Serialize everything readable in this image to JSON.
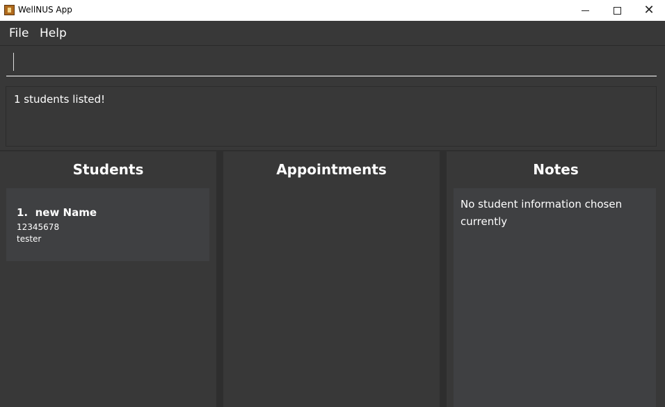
{
  "window": {
    "title": "WellNUS App",
    "icon": "app-icon"
  },
  "menu": {
    "file": "File",
    "help": "Help"
  },
  "command": {
    "value": "",
    "placeholder": ""
  },
  "result": {
    "text": "1 students listed!"
  },
  "panes": {
    "students": {
      "title": "Students"
    },
    "appointments": {
      "title": "Appointments"
    },
    "notes": {
      "title": "Notes",
      "empty_text": "No student information chosen currently"
    }
  },
  "students": [
    {
      "index": "1.",
      "name": "new Name",
      "phone": "12345678",
      "tag": "tester"
    }
  ]
}
